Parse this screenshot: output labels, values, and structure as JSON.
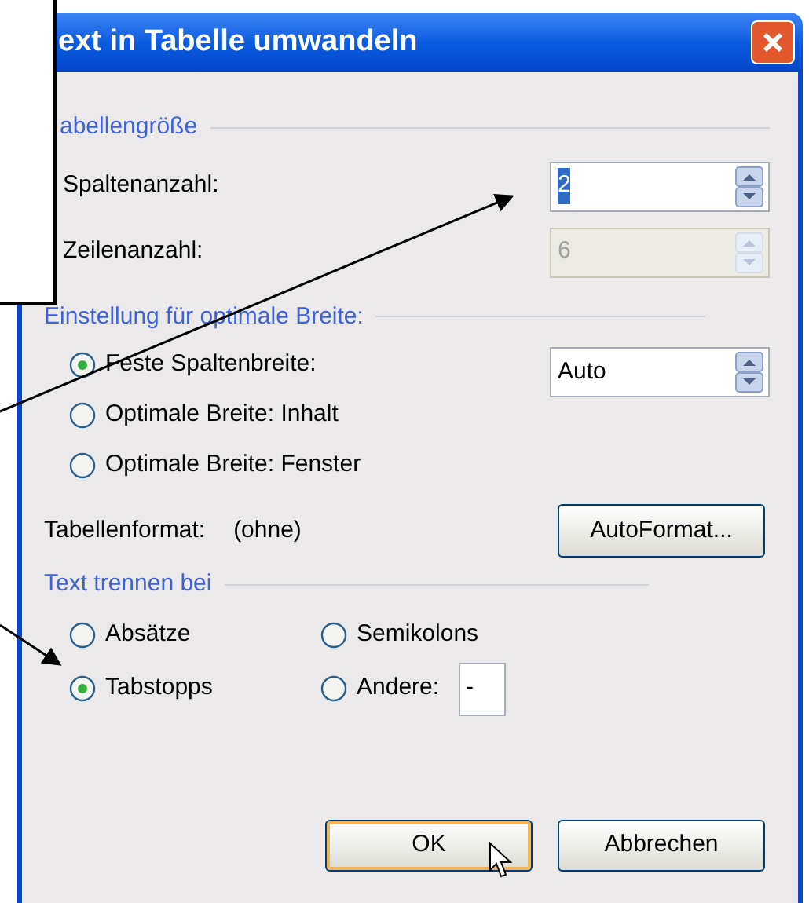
{
  "window": {
    "title": "ext in Tabelle umwandeln"
  },
  "table_size": {
    "title": "abellengröße",
    "fields": [
      {
        "label": "Spaltenanzahl:",
        "value": "2",
        "disabled": false,
        "text_selected": true
      },
      {
        "label": "Zeilenanzahl:",
        "value": "6",
        "disabled": true,
        "text_selected": false
      }
    ]
  },
  "width_settings": {
    "title": "Einstellung für optimale Breite:",
    "options": [
      {
        "label": "Feste Spaltenbreite:",
        "selected": true
      },
      {
        "label": "Optimale Breite: Inhalt",
        "selected": false
      },
      {
        "label": "Optimale Breite: Fenster",
        "selected": false
      }
    ],
    "width_field": {
      "value": "Auto"
    }
  },
  "table_format": {
    "label": "Tabellenformat:",
    "value": "(ohne)",
    "button": "AutoFormat..."
  },
  "separator": {
    "title": "Text trennen bei",
    "options": [
      {
        "label": "Absätze",
        "selected": false
      },
      {
        "label": "Semikolons",
        "selected": false
      },
      {
        "label": "Tabstopps",
        "selected": true
      },
      {
        "label": "Andere:",
        "selected": false,
        "field": "-"
      }
    ]
  },
  "buttons": [
    {
      "label": "OK",
      "default": true
    },
    {
      "label": "Abbrechen",
      "default": false
    }
  ]
}
